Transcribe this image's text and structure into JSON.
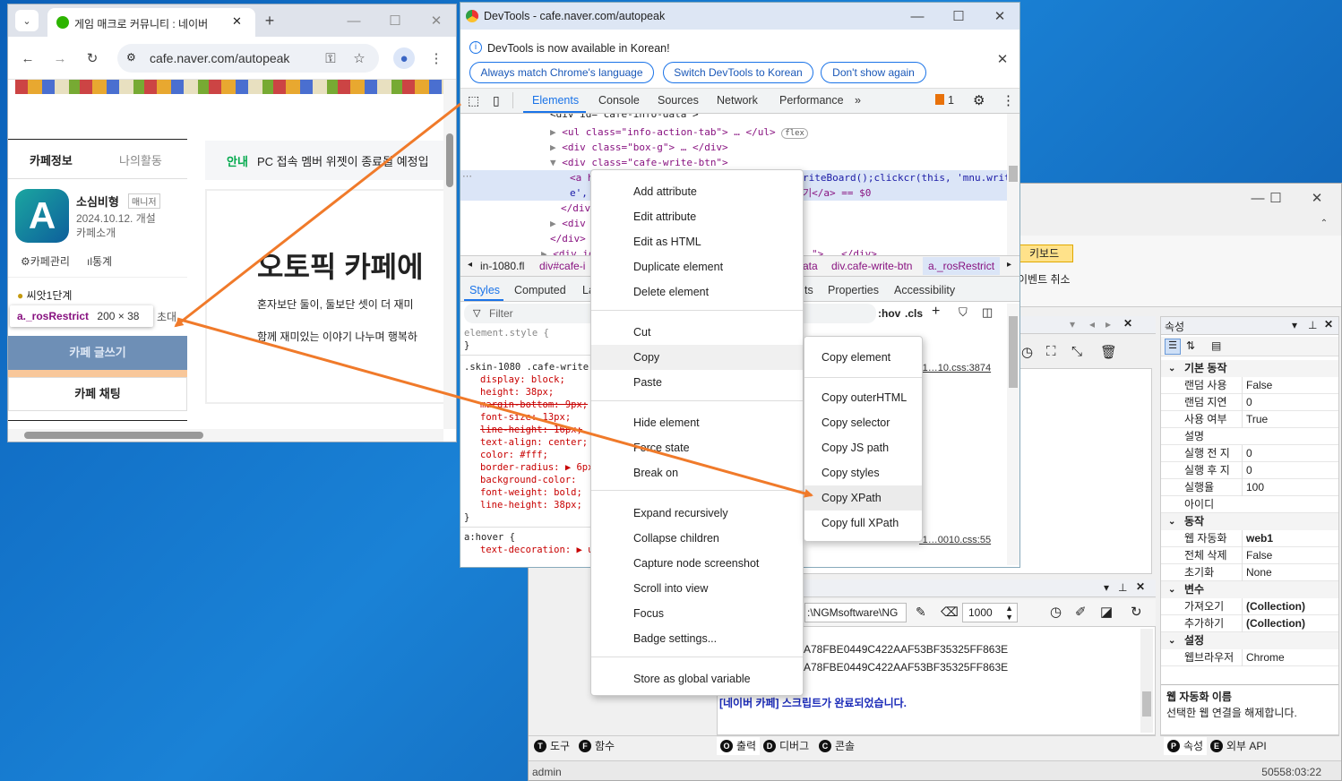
{
  "browser": {
    "tab_title": "게임 매크로 커뮤니티 : 네이버",
    "url": "cafe.naver.com/autopeak",
    "cafe_tabs": [
      "카페정보",
      "나의활동"
    ],
    "notice_label": "안내",
    "notice_text": "PC 접속 멤버 위젯이 종료될 예정입",
    "cafe_name": "소심비형",
    "manager_badge": "매니저",
    "created": "2024.10.12. 개설",
    "intro": "카페소개",
    "manage": "카페관리",
    "stats": "통계",
    "level": "씨앗1단계",
    "invite": "초대",
    "tooltip_selector": "a._rosRestrict",
    "tooltip_size": "200 × 38",
    "write_button": "카페 글쓰기",
    "chat_button": "카페 채팅",
    "headline": "오토픽 카페에",
    "body_line1": "혼자보단 둘이, 둘보단 셋이 더 재미",
    "body_line2": "함께 재미있는 이야기 나누며 행복하"
  },
  "devtools": {
    "title": "DevTools - cafe.naver.com/autopeak",
    "info_text": "DevTools is now available in Korean!",
    "info_buttons": [
      "Always match Chrome's language",
      "Switch DevTools to Korean",
      "Don't show again"
    ],
    "tabs": [
      "Elements",
      "Console",
      "Sources",
      "Network",
      "Performance"
    ],
    "issues_count": "1",
    "breadcrumb": [
      "in-1080.fl",
      "div#cafe-i",
      "ata",
      "div.cafe-write-btn",
      "a._rosRestrict"
    ],
    "style_tabs": [
      "Styles",
      "Computed",
      "La",
      "ts",
      "Properties",
      "Accessibility"
    ],
    "filter_placeholder": "Filter",
    "hov": ":hov",
    "cls": ".cls",
    "css_link1": "-1…10.css:3874",
    "css_link2": "-1…0010.css:55",
    "dom_lines": {
      "l0": "<div id=\"cafe-info-data\">",
      "l1": "<ul class=\"info-action-tab\"> … </ul>",
      "l2": "<div class=\"box-g\"> … </div>",
      "l3": "<div class=\"cafe-write-btn\">",
      "l4a": "<a h",
      "l4b": "riteBoard();clickcr(this, 'mnu.writ",
      "l5a": "e',",
      "l5b": "기</a> == $0",
      "l6": "</div>",
      "l7": "<div c",
      "l8": "</div>",
      "l9": "<div id",
      "l9b": "\"> … </div>"
    },
    "flex_badge": "flex",
    "css_rules": [
      "element.style {",
      "}",
      ".skin-1080 .cafe-write-b",
      "display: block;",
      "height: 38px;",
      "margin-bottom: 9px;",
      "font-size: 13px;",
      "line-height: 16px;",
      "text-align: center;",
      "color: #fff;",
      "border-radius: ▶ 6px;",
      "background-color:",
      "font-weight: bold;",
      "line-height: 38px;",
      "}",
      "a:hover {",
      "text-decoration: ▶ un"
    ]
  },
  "context_menu": {
    "items": [
      "Add attribute",
      "Edit attribute",
      "Edit as HTML",
      "Duplicate element",
      "Delete element",
      "Cut",
      "Copy",
      "Paste",
      "Hide element",
      "Force state",
      "Break on",
      "Expand recursively",
      "Collapse children",
      "Capture node screenshot",
      "Scroll into view",
      "Focus",
      "Badge settings...",
      "Store as global variable"
    ]
  },
  "copy_submenu": {
    "items": [
      "Copy element",
      "Copy outerHTML",
      "Copy selector",
      "Copy JS path",
      "Copy styles",
      "Copy XPath",
      "Copy full XPath"
    ],
    "highlighted": "Copy XPath"
  },
  "ngm": {
    "keyboard_button": "키보드",
    "cancel_event": "이벤트 취소",
    "properties_title": "속성",
    "categories": [
      {
        "name": "기본 동작",
        "rows": [
          [
            "랜덤 사용",
            "False"
          ],
          [
            "랜덤 지연",
            "0"
          ],
          [
            "사용 여부",
            "True"
          ],
          [
            "설명",
            ""
          ],
          [
            "실행 전 지",
            "0"
          ],
          [
            "실행 후 지",
            "0"
          ],
          [
            "실행율",
            "100"
          ],
          [
            "아이디",
            ""
          ]
        ]
      },
      {
        "name": "동작",
        "rows": [
          [
            "웹 자동화",
            "web1"
          ],
          [
            "전체 삭제",
            "False"
          ],
          [
            "초기화",
            "None"
          ]
        ]
      },
      {
        "name": "변수",
        "rows": [
          [
            "가져오기",
            "(Collection)"
          ],
          [
            "추가하기",
            "(Collection)"
          ]
        ]
      },
      {
        "name": "설정",
        "rows": [
          [
            "웹브라우저",
            "Chrome"
          ]
        ]
      }
    ],
    "desc_title": "웹 자동화 이름",
    "desc_text": "선택한 웹 연결을 해제합니다.",
    "path_value": ":\\NGMsoftware\\NG",
    "delay_value": "1000",
    "log_lines": [
      "A78FBE0449C422AAF53BF35325FF863E",
      "A78FBE0449C422AAF53BF35325FF863E",
      "[네이버 카페] 스크립트가 완료되었습니다."
    ],
    "left_tabs": [
      {
        "letter": "T",
        "label": "도구"
      },
      {
        "letter": "F",
        "label": "함수"
      }
    ],
    "output_tabs": [
      {
        "letter": "O",
        "label": "출력"
      },
      {
        "letter": "D",
        "label": "디버그"
      },
      {
        "letter": "C",
        "label": "콘솔"
      }
    ],
    "right_tabs": [
      {
        "letter": "P",
        "label": "속성"
      },
      {
        "letter": "E",
        "label": "외부 API"
      }
    ],
    "status_user": "admin",
    "status_right": "50558:03:22"
  },
  "colors": {
    "arrow": "#f07a2a",
    "write_btn": "#6e8fb6",
    "selection": "#dbe5f7"
  }
}
